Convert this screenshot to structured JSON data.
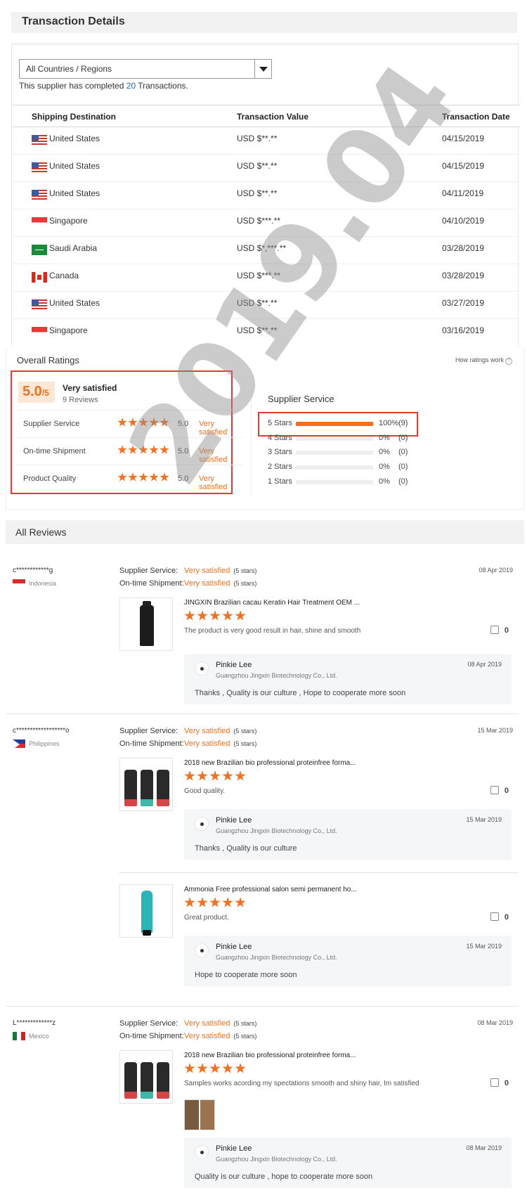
{
  "transaction": {
    "title": "Transaction Details",
    "region_select": "All Countries / Regions",
    "completed_prefix": "This supplier has completed",
    "completed_count": "20",
    "completed_suffix": "Transactions.",
    "columns": [
      "Shipping Destination",
      "Transaction Value",
      "Transaction Date"
    ],
    "rows": [
      {
        "flag": "us-flag-icon",
        "destination": "United States",
        "value": "USD $**.**",
        "date": "04/15/2019"
      },
      {
        "flag": "us-flag-icon",
        "destination": "United States",
        "value": "USD $**.**",
        "date": "04/15/2019"
      },
      {
        "flag": "us-flag-icon",
        "destination": "United States",
        "value": "USD $**.**",
        "date": "04/11/2019"
      },
      {
        "flag": "sg-flag-icon",
        "destination": "Singapore",
        "value": "USD $***.**",
        "date": "04/10/2019"
      },
      {
        "flag": "sa-flag-icon",
        "destination": "Saudi Arabia",
        "value": "USD $*,***.**",
        "date": "03/28/2019"
      },
      {
        "flag": "ca-flag-icon",
        "destination": "Canada",
        "value": "USD $***.**",
        "date": "03/28/2019"
      },
      {
        "flag": "us-flag-icon",
        "destination": "United States",
        "value": "USD $**.**",
        "date": "03/27/2019"
      },
      {
        "flag": "sg-flag-icon",
        "destination": "Singapore",
        "value": "USD $**.**",
        "date": "03/16/2019"
      }
    ]
  },
  "ratings": {
    "title": "Overall Ratings",
    "how_link": "How ratings work",
    "score": "5.0",
    "score_max": "/5",
    "score_label": "Very satisfied",
    "review_count": "9 Reviews",
    "categories": [
      {
        "label": "Supplier Service",
        "stars": 5,
        "value": "5.0",
        "verdict": "Very satisfied"
      },
      {
        "label": "On-time Shipment",
        "stars": 5,
        "value": "5.0",
        "verdict": "Very satisfied"
      },
      {
        "label": "Product Quality",
        "stars": 5,
        "value": "5.0",
        "verdict": "Very satisfied"
      }
    ],
    "service_title": "Supplier Service",
    "distribution": [
      {
        "label": "5 Stars",
        "fraction": 1.0,
        "pct": "100%",
        "count": "(9)"
      },
      {
        "label": "4 Stars",
        "fraction": 0,
        "pct": "0%",
        "count": "(0)"
      },
      {
        "label": "3 Stars",
        "fraction": 0,
        "pct": "0%",
        "count": "(0)"
      },
      {
        "label": "2 Stars",
        "fraction": 0,
        "pct": "0%",
        "count": "(0)"
      },
      {
        "label": "1 Stars",
        "fraction": 0,
        "pct": "0%",
        "count": "(0)"
      }
    ]
  },
  "watermark": "2019.04",
  "reviews": {
    "title": "All Reviews",
    "service_label": "Supplier Service:",
    "shipment_label": "On-time Shipment:",
    "verdict": "Very satisfied",
    "stars_note": "(5 stars)",
    "supplier_name": "Pinkie Lee",
    "supplier_company": "Guangzhou Jingxin Biotechnology Co., Ltd.",
    "items": [
      {
        "user": "c************g",
        "country": "Indonesia",
        "date": "08 Apr 2019",
        "products": [
          {
            "title": "JINGXIN Brazilian cacau Keratin Hair Treatment OEM ...",
            "stars": 5,
            "text": "The product is very good result in hair, shine and smooth",
            "likes": "0",
            "reply_date": "08 Apr 2019",
            "reply": "Thanks , Quality is our culture , Hope to cooperate more soon"
          }
        ]
      },
      {
        "user": "c******************o",
        "country": "Philippines",
        "date": "15 Mar 2019",
        "products": [
          {
            "title": "2018 new Brazilian bio professional proteinfree forma...",
            "stars": 5,
            "text": "Good quality.",
            "likes": "0",
            "reply_date": "15 Mar 2019",
            "reply": "Thanks , Quality is our culture"
          },
          {
            "title": "Ammonia Free professional salon semi permanent ho...",
            "stars": 5,
            "text": "Great product.",
            "likes": "0",
            "reply_date": "15 Mar 2019",
            "reply": "Hope to cooperate more soon"
          }
        ]
      },
      {
        "user": "L*************z",
        "country": "Mexico",
        "date": "08 Mar 2019",
        "products": [
          {
            "title": "2018 new Brazilian bio professional proteinfree forma...",
            "stars": 5,
            "text": "Samples works acording my spectations smooth and shiny hair, Im satisfied",
            "likes": "0",
            "reply_date": "08 Mar 2019",
            "reply": "Quality is our culture  , hope to cooperate more soon"
          }
        ]
      }
    ]
  }
}
